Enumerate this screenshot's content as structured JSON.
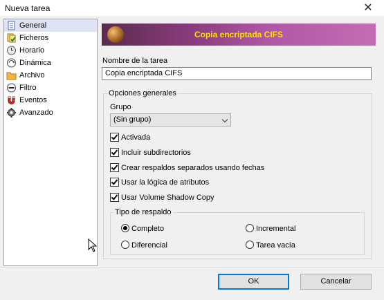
{
  "window": {
    "title": "Nueva tarea"
  },
  "sidebar": {
    "items": [
      {
        "label": "General",
        "icon": "document-icon",
        "selected": true
      },
      {
        "label": "Ficheros",
        "icon": "files-icon",
        "selected": false
      },
      {
        "label": "Horario",
        "icon": "clock-icon",
        "selected": false
      },
      {
        "label": "Dinámica",
        "icon": "dynamic-icon",
        "selected": false
      },
      {
        "label": "Archivo",
        "icon": "folder-icon",
        "selected": false
      },
      {
        "label": "Filtro",
        "icon": "filter-icon",
        "selected": false
      },
      {
        "label": "Eventos",
        "icon": "magnet-icon",
        "selected": false
      },
      {
        "label": "Avanzado",
        "icon": "gear-icon",
        "selected": false
      }
    ]
  },
  "banner": {
    "title": "Copia encriptada CIFS",
    "title_color": "#ffe100"
  },
  "task_name": {
    "label": "Nombre de la tarea",
    "value": "Copia encriptada CIFS"
  },
  "general_options": {
    "title": "Opciones generales",
    "group_label": "Grupo",
    "group_value": "(Sin grupo)",
    "checkboxes": [
      {
        "label": "Activada",
        "checked": true
      },
      {
        "label": "Incluir subdirectorios",
        "checked": true
      },
      {
        "label": "Crear respaldos separados usando fechas",
        "checked": true
      },
      {
        "label": "Usar la lógica de atributos",
        "checked": true
      },
      {
        "label": "Usar Volume Shadow Copy",
        "checked": true
      }
    ]
  },
  "backup_type": {
    "title": "Tipo de respaldo",
    "options": [
      {
        "label": "Completo",
        "selected": true
      },
      {
        "label": "Incremental",
        "selected": false
      },
      {
        "label": "Diferencial",
        "selected": false
      },
      {
        "label": "Tarea vacía",
        "selected": false
      }
    ]
  },
  "buttons": {
    "ok": "OK",
    "cancel": "Cancelar",
    "accent": "#0078d7"
  }
}
